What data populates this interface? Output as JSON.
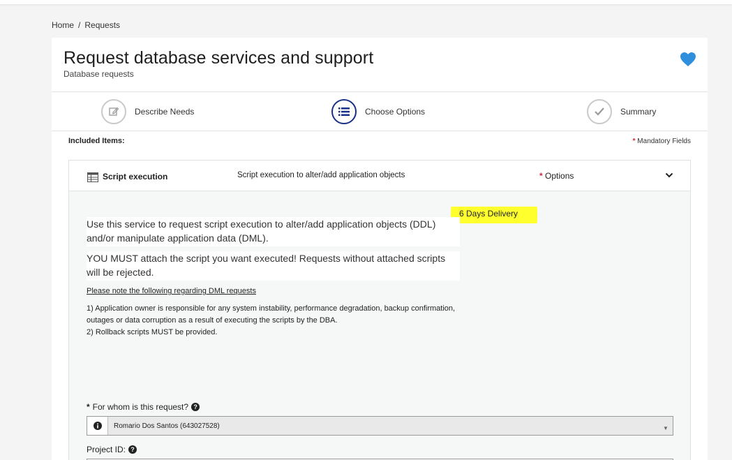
{
  "breadcrumb": {
    "home": "Home",
    "sep": "/",
    "current": "Requests"
  },
  "header": {
    "title": "Request database services and support",
    "subtitle": "Database requests",
    "favorite_icon": "heart-icon",
    "favorite_color": "#2f8fdc"
  },
  "stepper": {
    "steps": [
      {
        "label": "Describe Needs",
        "icon": "edit-icon"
      },
      {
        "label": "Choose Options",
        "icon": "list-icon",
        "active": true
      },
      {
        "label": "Summary",
        "icon": "check-icon"
      }
    ],
    "active_color": "#1a2f8a"
  },
  "included_items_label": "Included Items:",
  "mandatory": {
    "star": "*",
    "label": "Mandatory Fields"
  },
  "item": {
    "name": "Script execution",
    "description": "Script execution to alter/add application objects",
    "options_star": "*",
    "options_label": "Options",
    "delivery": "6 Days Delivery",
    "para1": "Use this service to request script execution to alter/add application objects (DDL) and/or manipulate application data (DML).",
    "para2": "YOU MUST attach the script you want executed! Requests without attached scripts will be rejected.",
    "note_heading": "Please note the following regarding DML requests",
    "note_line1": "1) Application owner is responsible for any system instability, performance degradation, backup confirmation, outages or data corruption as a result of executing the scripts by the DBA.",
    "note_line2": "2) Rollback scripts MUST be provided."
  },
  "form": {
    "whom_star": "*",
    "whom_label": "For whom is this request?",
    "whom_value": "Romario Dos Santos (643027528)",
    "project_label": "Project ID:"
  }
}
